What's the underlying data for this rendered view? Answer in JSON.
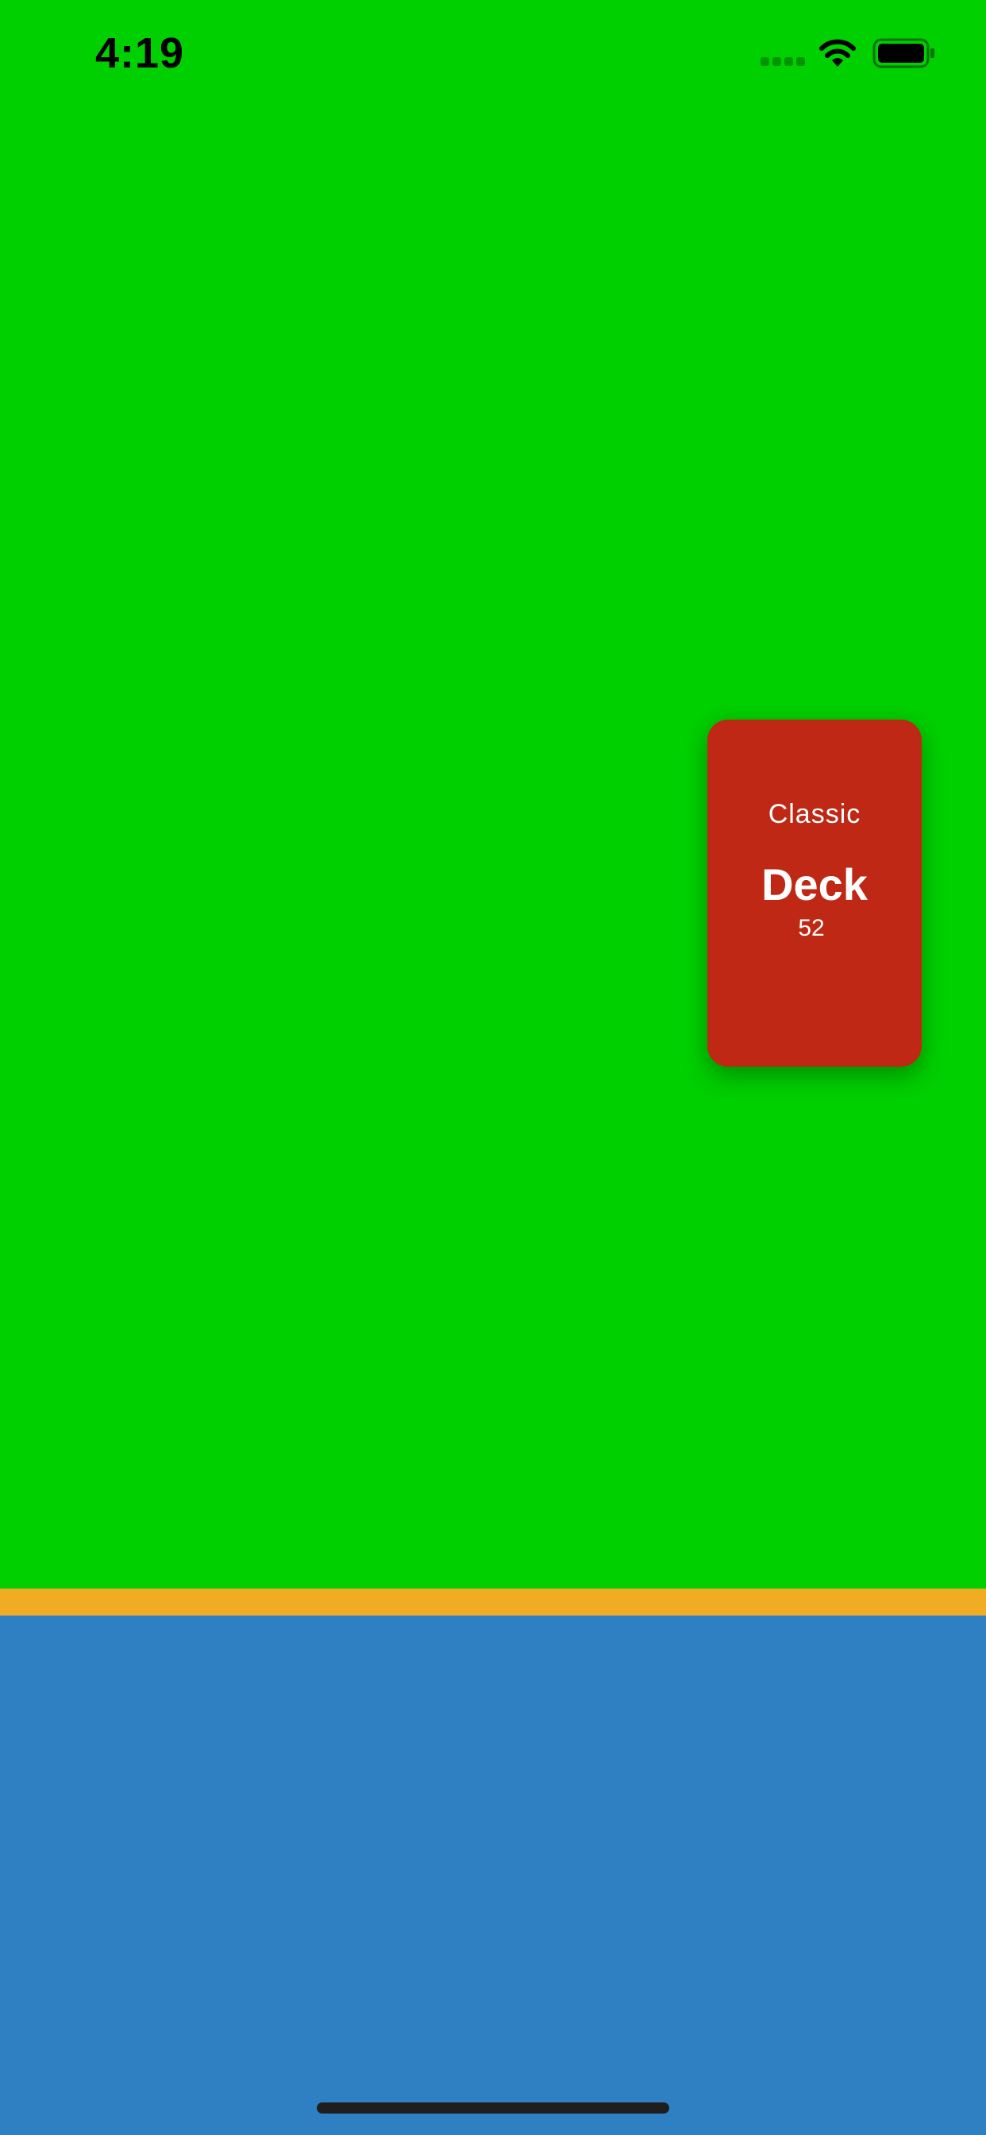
{
  "status_bar": {
    "time": "4:19",
    "icons": [
      "cell-signal-icon",
      "wifi-icon",
      "battery-icon"
    ]
  },
  "colors": {
    "table": "#00cf00",
    "divider": "#f0ad23",
    "bottom": "#2f80c3",
    "card": "#be2815"
  },
  "deck": {
    "subtitle": "Classic",
    "title": "Deck",
    "count": "52"
  }
}
